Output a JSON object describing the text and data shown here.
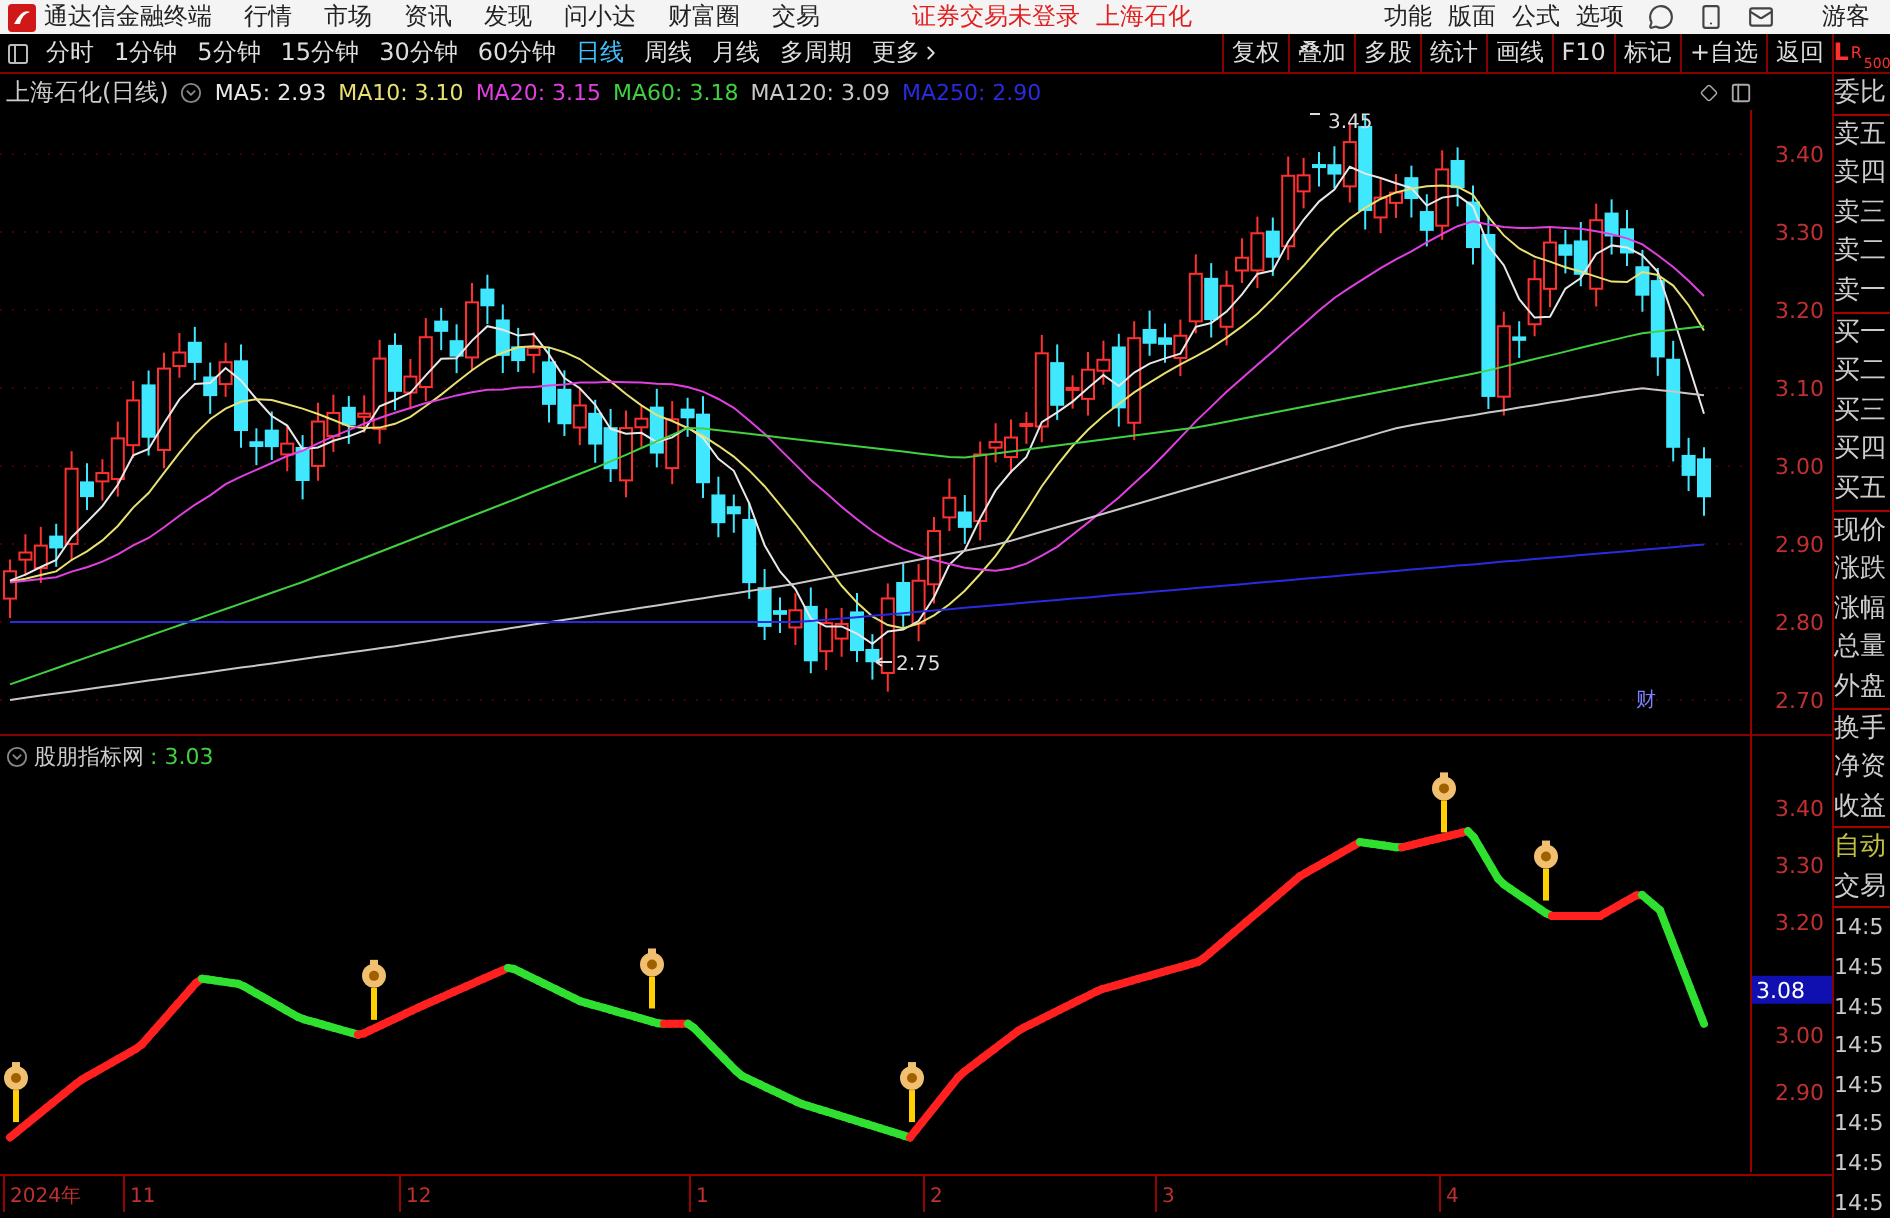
{
  "title_bar": {
    "app_name": "通达信金融终端",
    "menu": [
      "行情",
      "市场",
      "资讯",
      "发现",
      "问小达",
      "财富圈",
      "交易"
    ],
    "notice": "证券交易未登录",
    "stock": "上海石化",
    "right_menu": [
      "功能",
      "版面",
      "公式",
      "选项"
    ],
    "user": "游客"
  },
  "period_tabs": [
    {
      "label": "分时",
      "selected": false
    },
    {
      "label": "1分钟",
      "selected": false
    },
    {
      "label": "5分钟",
      "selected": false
    },
    {
      "label": "15分钟",
      "selected": false
    },
    {
      "label": "30分钟",
      "selected": false
    },
    {
      "label": "60分钟",
      "selected": false
    },
    {
      "label": "日线",
      "selected": true
    },
    {
      "label": "周线",
      "selected": false
    },
    {
      "label": "月线",
      "selected": false
    },
    {
      "label": "多周期",
      "selected": false
    },
    {
      "label": "更多",
      "selected": false
    }
  ],
  "tool_buttons": [
    "复权",
    "叠加",
    "多股",
    "统计",
    "画线",
    "F10",
    "标记",
    "+自选",
    "返回"
  ],
  "lr_switch": {
    "options": [
      {
        "label": "L",
        "selected": true
      },
      {
        "label": "R",
        "selected": false
      }
    ],
    "sub": "500"
  },
  "main_chart": {
    "title": "上海石化(日线)",
    "indicators": [
      {
        "label": "MA5: 2.93",
        "color": "#e8e8e8"
      },
      {
        "label": "MA10: 3.10",
        "color": "#e8e070"
      },
      {
        "label": "MA20: 3.15",
        "color": "#e040e0"
      },
      {
        "label": "MA60: 3.18",
        "color": "#40d040"
      },
      {
        "label": "MA120: 3.09",
        "color": "#c8c8c8"
      },
      {
        "label": "MA250: 2.90",
        "color": "#2a2ae0"
      }
    ],
    "y_labels": [
      "3.40",
      "3.30",
      "3.20",
      "3.10",
      "3.00",
      "2.90",
      "2.80",
      "2.70"
    ],
    "high_label": "3.45",
    "low_label": "2.75",
    "marker": "财"
  },
  "sub_chart": {
    "title": "股朋指标网",
    "value": ": 3.03",
    "y_labels": [
      "3.40",
      "3.30",
      "3.20",
      "3.00",
      "2.90"
    ],
    "current": "3.08"
  },
  "x_axis": [
    "2024年",
    "11",
    "12",
    "1",
    "2",
    "3",
    "4"
  ],
  "side_panel": {
    "groups": [
      [
        "委比"
      ],
      [
        "卖五",
        "卖四",
        "卖三",
        "卖二",
        "卖一"
      ],
      [
        "买一",
        "买二",
        "买三",
        "买四",
        "买五"
      ],
      [
        "现价",
        "涨跌",
        "涨幅",
        "总量",
        "外盘"
      ],
      [
        "换手",
        "净资",
        "收益"
      ]
    ],
    "auto": "自动",
    "trades_header": "交易",
    "trade_times": [
      "14:5",
      "14:5",
      "14:5",
      "14:5",
      "14:5",
      "14:5",
      "14:5",
      "14:5"
    ]
  }
}
